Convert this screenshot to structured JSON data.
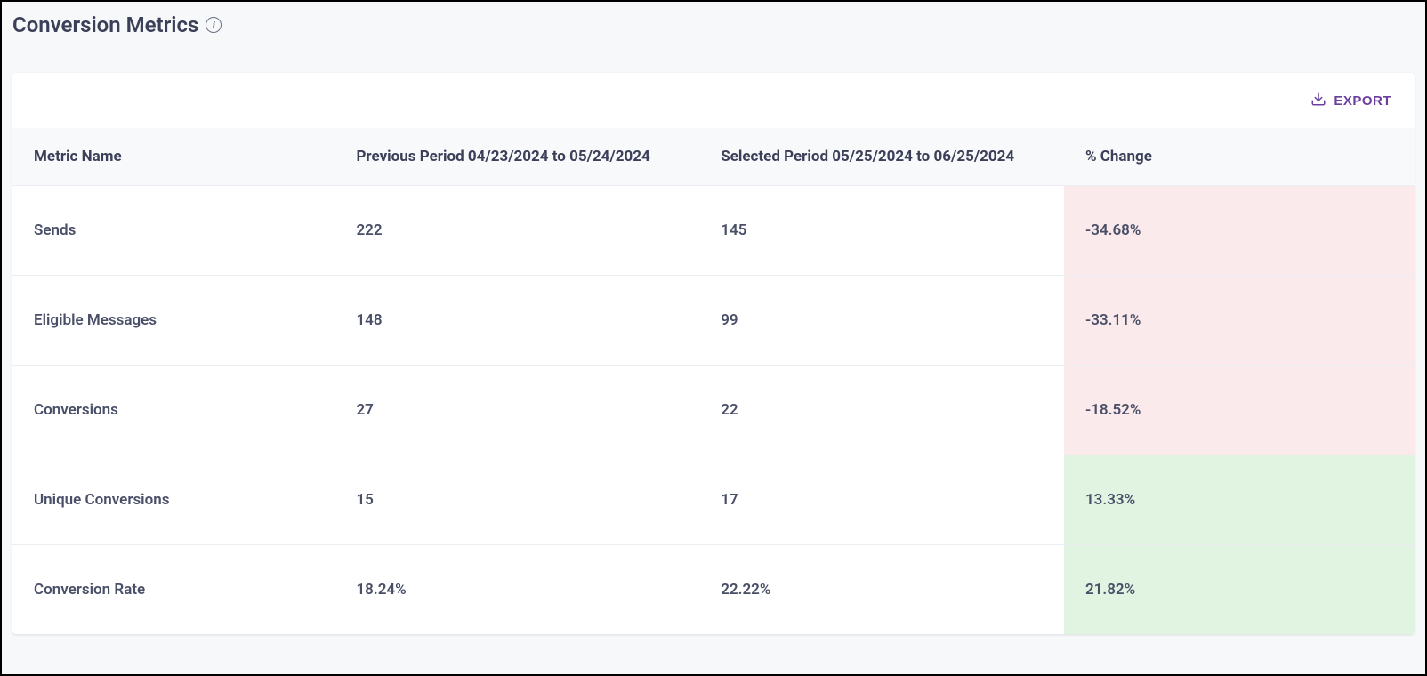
{
  "header": {
    "title": "Conversion Metrics",
    "info_symbol": "i"
  },
  "toolbar": {
    "export_label": "EXPORT"
  },
  "table": {
    "columns": {
      "metric": "Metric Name",
      "previous": "Previous Period 04/23/2024 to 05/24/2024",
      "selected": "Selected Period 05/25/2024 to 06/25/2024",
      "change": "% Change"
    },
    "rows": [
      {
        "metric": "Sends",
        "previous": "222",
        "selected": "145",
        "change": "-34.68%",
        "change_dir": "neg"
      },
      {
        "metric": "Eligible Messages",
        "previous": "148",
        "selected": "99",
        "change": "-33.11%",
        "change_dir": "neg"
      },
      {
        "metric": "Conversions",
        "previous": "27",
        "selected": "22",
        "change": "-18.52%",
        "change_dir": "neg"
      },
      {
        "metric": "Unique Conversions",
        "previous": "15",
        "selected": "17",
        "change": "13.33%",
        "change_dir": "pos"
      },
      {
        "metric": "Conversion Rate",
        "previous": "18.24%",
        "selected": "22.22%",
        "change": "21.82%",
        "change_dir": "pos"
      }
    ]
  }
}
